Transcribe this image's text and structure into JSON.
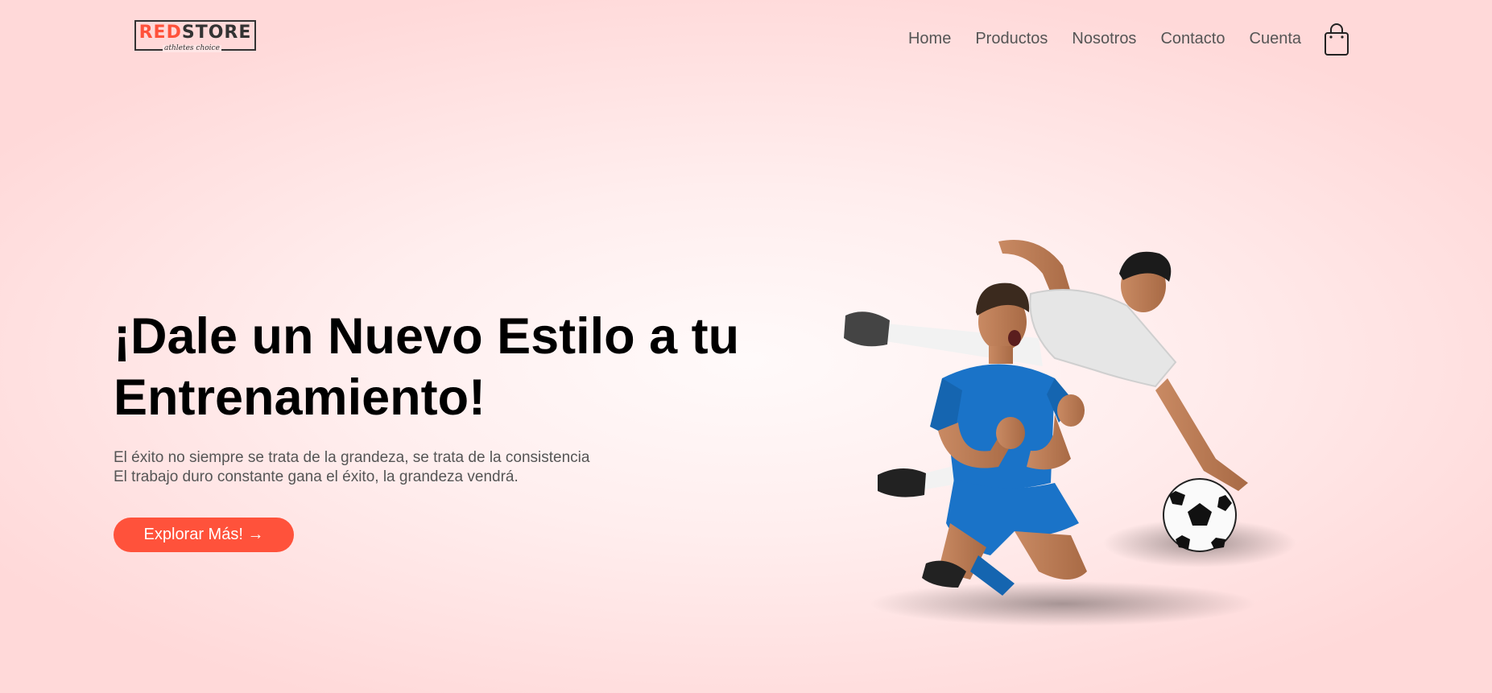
{
  "header": {
    "logo": {
      "red": "RED",
      "store": "STORE",
      "tagline": "athletes choice"
    },
    "nav": [
      "Home",
      "Productos",
      "Nosotros",
      "Contacto",
      "Cuenta"
    ],
    "cart_icon": "shopping-bag-icon"
  },
  "hero": {
    "title_line1": "¡Dale un Nuevo Estilo a tu",
    "title_line2": "Entrenamiento!",
    "desc_line1": "El éxito no siempre se trata de la grandeza, se trata de la consistencia",
    "desc_line2": "El trabajo duro constante gana el éxito, la grandeza vendrá.",
    "button_label": "Explorar Más! →",
    "image": "soccer-players-image"
  },
  "colors": {
    "accent": "#ff523b",
    "text": "#555555",
    "heading": "#000000",
    "jersey_blue": "#1a73c8"
  }
}
